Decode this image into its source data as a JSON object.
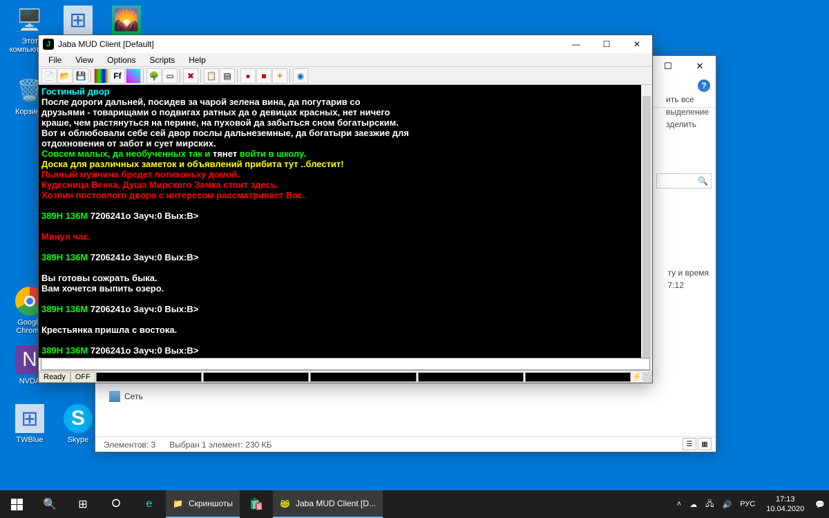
{
  "desktop_icons": {
    "computer": "Этот\nкомпьюте...",
    "exe": " ",
    "pic": " ",
    "bin": "Корзина",
    "chrome": "Google\nChrome",
    "nvda": "NVDA",
    "twblue": "TWBlue",
    "skype": "Skype"
  },
  "explorer": {
    "ribbon": {
      "i1": "ить все",
      "i2": "выделение",
      "i3": "зделить"
    },
    "side": {
      "i1": "ту и время",
      "i2": "7:12"
    },
    "net": "Сеть",
    "status": {
      "count": "Элементов: 3",
      "sel": "Выбран 1 элемент: 230 КБ"
    }
  },
  "mud": {
    "title": "Jaba MUD Client [Default]",
    "menu": {
      "file": "File",
      "view": "View",
      "options": "Options",
      "scripts": "Scripts",
      "help": "Help"
    },
    "status": {
      "ready": "Ready",
      "off": "OFF"
    },
    "term": {
      "title": "Гостиный двор",
      "p1": "    После дороги дальней, посидев за чарой зелена вина, да погутарив со",
      "p2": "друзьями - товарищами о подвигах ратных да о девицах красных, нет ничего",
      "p3": "краше, чем растянуться на перине, на пуховой да забыться сном богатырским.",
      "p4": "Вот и облюбовали себе сей двор послы дальнеземные, да богатыри заезжие для",
      "p5": "отдохновения от забот и сует мирских.",
      "g1a": "Совсем малых, да необученных так и ",
      "g1b": "тянет",
      "g1c": " войти в школу.",
      "y1": "Доска для различных заметок и объявлений прибита тут ..блестит!",
      "r1": "Пьяный мужчина бредет потихоньку домой.",
      "r2": "Кудесница Венка, Душа Мирского Замка стоит здесь.",
      "r3": "Хозяин постоялого двора с интересом рассматривает Вас.",
      "hp": "389H",
      "mp": "136M",
      "rest": "7206241о Зауч:0 Вых:В>",
      "hour": "Минул час.",
      "eat": "Вы готовы сожрать быка.",
      "drink": "Вам хочется выпить озеро.",
      "east": "Крестьянка пришла с востока."
    }
  },
  "taskbar": {
    "t1": "Скриншоты",
    "t2": "Jaba MUD Client [D...",
    "lang": "РУС",
    "time": "17:13",
    "date": "10.04.2020"
  }
}
